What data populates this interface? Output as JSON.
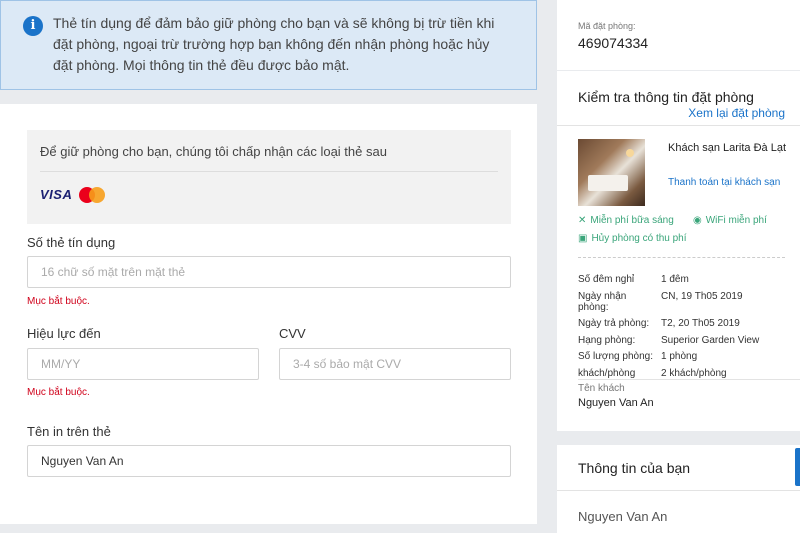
{
  "info_banner": {
    "icon": "info-icon",
    "line1": "Thẻ tín dụng để đảm bảo giữ phòng cho bạn và sẽ không bị trừ tiền khi",
    "line2": "đặt phòng, ngoại trừ trường hợp bạn không đến nhận phòng hoặc hủy",
    "line3": "đặt phòng. Mọi thông tin thẻ đều được bảo mật."
  },
  "accepted_cards": {
    "text": "Để giữ phòng cho bạn, chúng tôi chấp nhận các loại thẻ sau",
    "visa": "VISA",
    "mastercard_icon": "mastercard-icon"
  },
  "form": {
    "card_number": {
      "label": "Số thẻ tín dụng",
      "placeholder": "16 chữ số mặt trên mặt thẻ",
      "value": "",
      "error": "Mục bắt buộc."
    },
    "expiry": {
      "label": "Hiệu lực đến",
      "placeholder": "MM/YY",
      "value": "",
      "error": "Mục bắt buộc."
    },
    "cvv": {
      "label": "CVV",
      "placeholder": "3-4 số bảo mật CVV",
      "value": ""
    },
    "name_on_card": {
      "label": "Tên in trên thẻ",
      "value": "Nguyen Van An"
    }
  },
  "booking_code": {
    "label": "Mã đặt phòng:",
    "value": "469074334"
  },
  "check_booking": {
    "title": "Kiểm tra thông tin đặt phòng",
    "review_link": "Xem lại đặt phòng",
    "hotel_name": "Khách sạn Larita Đà Lạt",
    "payment_note": "Thanh toán tại khách sạn",
    "amenities": [
      {
        "icon": "utensils-icon",
        "label": "Miễn phí bữa sáng"
      },
      {
        "icon": "wifi-icon",
        "label": "WiFi miễn phí"
      },
      {
        "icon": "calendar-icon",
        "label": "Hủy phòng có thu phí"
      }
    ],
    "details": {
      "nights_label": "Số đêm nghỉ",
      "nights_value": "1 đêm",
      "checkin_label_1": "Ngày nhận",
      "checkin_label_2": "phòng:",
      "checkin_value": "CN, 19 Th05 2019",
      "checkout_label": "Ngày trả phòng:",
      "checkout_value": "T2, 20 Th05 2019",
      "roomtype_label": "Hạng phòng:",
      "roomtype_value": "Superior Garden View",
      "roomcount_label": "Số lượng phòng:",
      "roomcount_value": "1 phòng",
      "guests_label": "khách/phòng",
      "guests_value": "2 khách/phòng"
    },
    "guest_label": "Tên khách",
    "guest_name": "Nguyen Van An"
  },
  "your_info": {
    "title": "Thông tin của bạn",
    "name": "Nguyen Van An"
  },
  "colors": {
    "accent": "#1a73c9",
    "error": "#d0021b",
    "amenity": "#3aa57a",
    "banner_bg": "#dce9f6"
  }
}
